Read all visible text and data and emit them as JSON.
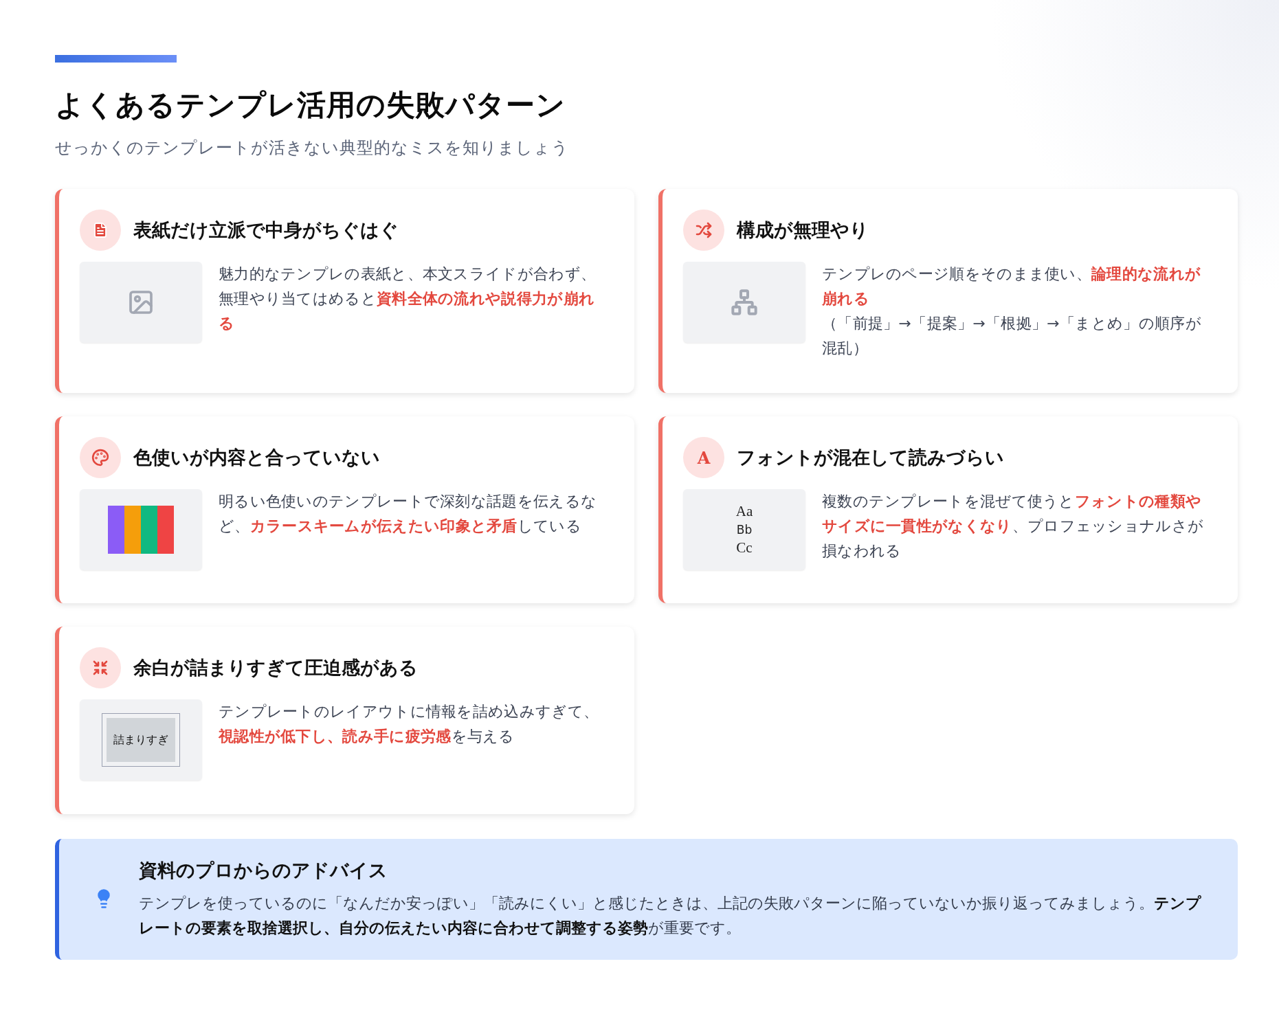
{
  "header": {
    "title": "よくあるテンプレ活用の失敗パターン",
    "subtitle": "せっかくのテンプレートが活きない典型的なミスを知りましょう"
  },
  "cards": [
    {
      "kind": "image",
      "title": "表紙だけ立派で中身がちぐはぐ",
      "paragraphs": [
        "魅力的なテンプレの表紙と、本文スライドが合わず、無理やり当てはめると**資料全体の流れや説得力が崩れる**"
      ]
    },
    {
      "kind": "hierarchy",
      "title": "構成が無理やり",
      "paragraphs": [
        "テンプレのページ順をそのまま使い、**論理的な流れが崩れる**",
        "（「前提」→「提案」→「根拠」→「まとめ」の順序が混乱）"
      ]
    },
    {
      "kind": "swatches",
      "title": "色使いが内容と合っていない",
      "paragraphs": [
        "明るい色使いのテンプレートで深刻な話題を伝えるなど、**カラースキームが伝えたい印象と矛盾**している"
      ]
    },
    {
      "kind": "fonts",
      "icon_text": "A",
      "title": "フォントが混在して読みづらい",
      "samples": [
        "Aa",
        "Bb",
        "Cc"
      ],
      "paragraphs": [
        "複数のテンプレートを混ぜて使うと**フォントの種類やサイズに一貫性がなくなり**、プロフェッショナルさが損なわれる"
      ]
    },
    {
      "kind": "crowded",
      "title": "余白が詰まりすぎて圧迫感がある",
      "label": "詰まりすぎ",
      "paragraphs": [
        "テンプレートのレイアウトに情報を詰め込みすぎて、**視認性が低下し、読み手に疲労感**を与える"
      ]
    }
  ],
  "advice": {
    "title": "資料のプロからのアドバイス",
    "text": "テンプレを使っているのに「なんだか安っぽい」「読みにくい」と感じたときは、上記の失敗パターンに陥っていないか振り返ってみましょう。**テンプレートの要素を取捨選択し、自分の伝えたい内容に合わせて調整する姿勢**が重要です。"
  }
}
